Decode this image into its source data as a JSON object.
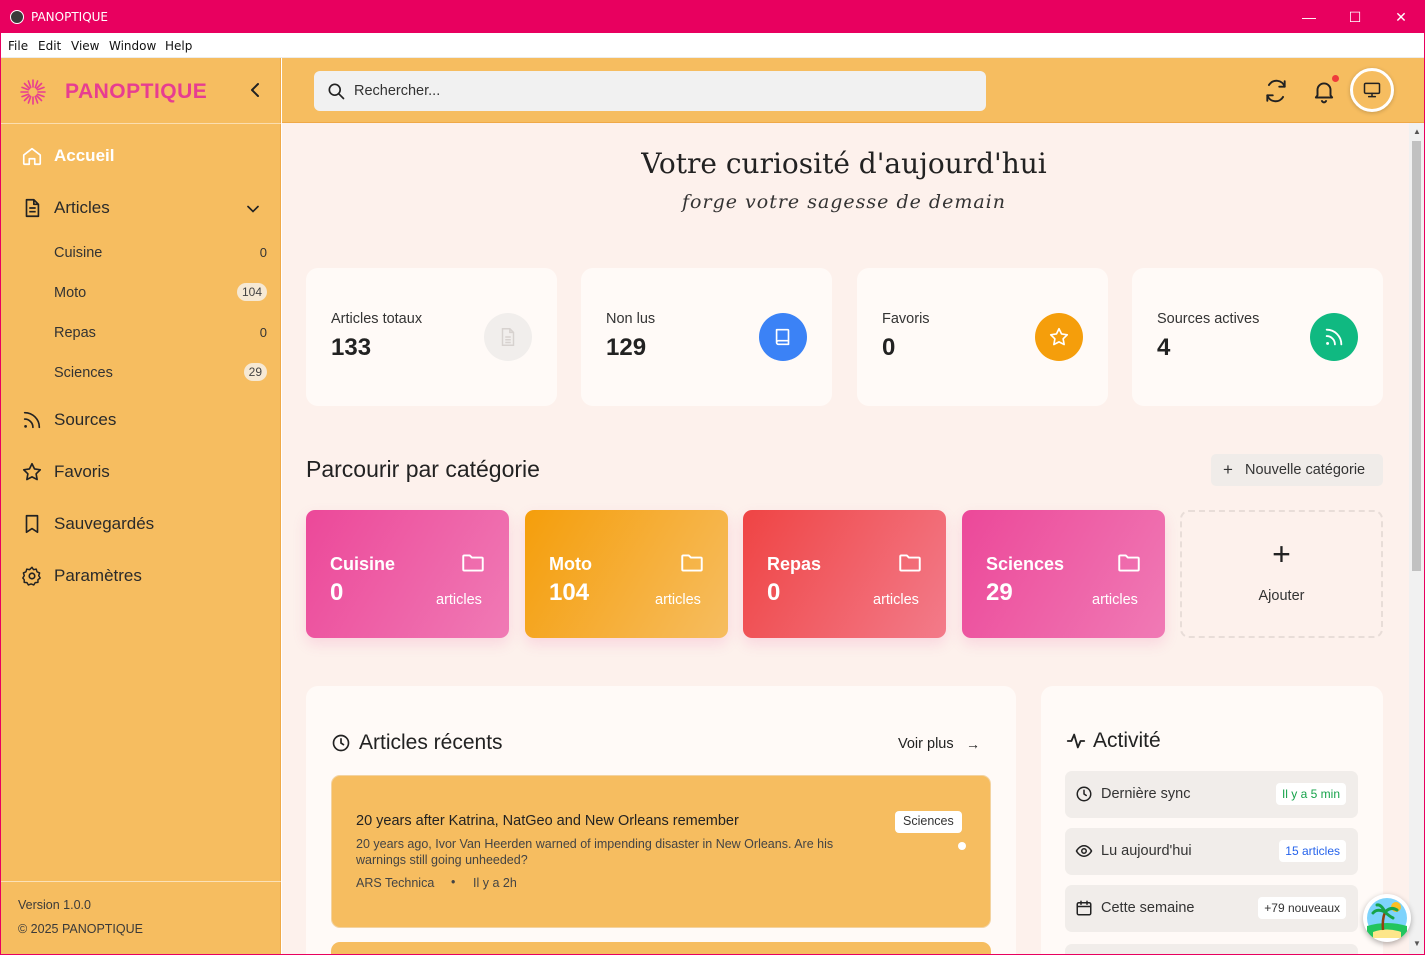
{
  "window": {
    "title": "PANOPTIQUE",
    "minimize_glyph": "—",
    "maximize_glyph": "☐",
    "close_glyph": "✕",
    "menu": [
      "File",
      "Edit",
      "View",
      "Window",
      "Help"
    ]
  },
  "colors": {
    "titlebar": "#e8005f",
    "sidebar": "#f6bd60",
    "brand": "#e73d91",
    "main_bg": "#fdf1ec",
    "card_bg": "#fffaf7"
  },
  "sidebar": {
    "brand": "PANOPTIQUE",
    "logo_icon": "sunburst-logo-icon",
    "collapse_icon": "chevron-left-icon",
    "items": [
      {
        "label": "Accueil",
        "icon": "home-icon",
        "active": true
      },
      {
        "label": "Articles",
        "icon": "document-icon",
        "expanded": true
      }
    ],
    "sub_items": [
      {
        "label": "Cuisine",
        "count": "0"
      },
      {
        "label": "Moto",
        "count": "104"
      },
      {
        "label": "Repas",
        "count": "0"
      },
      {
        "label": "Sciences",
        "count": "29"
      }
    ],
    "more_items": [
      {
        "label": "Sources",
        "icon": "rss-icon"
      },
      {
        "label": "Favoris",
        "icon": "star-icon"
      },
      {
        "label": "Sauvegardés",
        "icon": "bookmark-icon"
      },
      {
        "label": "Paramètres",
        "icon": "gear-icon"
      }
    ],
    "version": "Version 1.0.0",
    "copyright": "© 2025 PANOPTIQUE"
  },
  "topbar": {
    "search_placeholder": "Rechercher...",
    "icons": [
      "search-icon",
      "refresh-icon",
      "bell-icon",
      "monitor-icon"
    ]
  },
  "hero": {
    "headline": "Votre curiosité d'aujourd'hui",
    "subline": "forge votre sagesse de demain"
  },
  "stats": [
    {
      "label": "Articles totaux",
      "value": "133",
      "icon": "file-icon",
      "color": "#f1eeec"
    },
    {
      "label": "Non lus",
      "value": "129",
      "icon": "book-icon",
      "color": "#3b82f6"
    },
    {
      "label": "Favoris",
      "value": "0",
      "icon": "star-icon",
      "color": "#f59e0b"
    },
    {
      "label": "Sources actives",
      "value": "4",
      "icon": "rss-icon",
      "color": "#10b981"
    }
  ],
  "categories_section": {
    "title": "Parcourir par catégorie",
    "new_button": "Nouvelle catégorie",
    "plus_glyph": "+",
    "add_label": "Ajouter",
    "unit": "articles",
    "items": [
      {
        "name": "Cuisine",
        "count": "0"
      },
      {
        "name": "Moto",
        "count": "104"
      },
      {
        "name": "Repas",
        "count": "0"
      },
      {
        "name": "Sciences",
        "count": "29"
      }
    ]
  },
  "recent": {
    "title": "Articles récents",
    "more": "Voir plus",
    "more_arrow": "→",
    "articles": [
      {
        "title": "20 years after Katrina, NatGeo and New Orleans remember",
        "description": "20 years ago, Ivor Van Heerden warned of impending disaster in New Orleans. Are his warnings still going unheeded?",
        "source": "ARS Technica",
        "separator": "•",
        "time": "Il y a 2h",
        "tag": "Sciences"
      }
    ]
  },
  "activity": {
    "title": "Activité",
    "rows": [
      {
        "label": "Dernière sync",
        "value": "Il y a 5 min",
        "icon": "clock-icon",
        "color": "#16a34a"
      },
      {
        "label": "Lu aujourd'hui",
        "value": "15 articles",
        "icon": "eye-icon",
        "color": "#2563eb"
      },
      {
        "label": "Cette semaine",
        "value": "+79 nouveaux",
        "icon": "calendar-icon",
        "color": "#333333"
      }
    ]
  }
}
